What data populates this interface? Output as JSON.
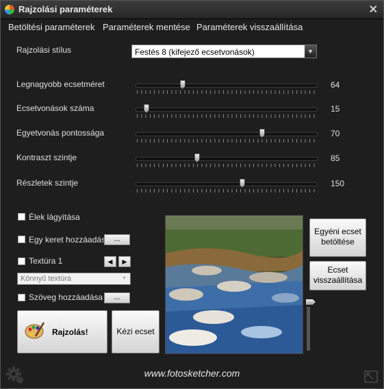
{
  "window": {
    "title": "Rajzolási paraméterek",
    "close_glyph": "✕"
  },
  "menu": [
    {
      "label": "Betöltési paraméterek"
    },
    {
      "label": "Paraméterek mentése"
    },
    {
      "label": "Paraméterek visszaállítása"
    }
  ],
  "style": {
    "label": "Rajzolási stílus",
    "selected": "Festés 8 (kifejező ecsetvonások)",
    "arrow_glyph": "▼"
  },
  "sliders": [
    {
      "label": "Legnagyobb ecsetméret",
      "value": "64",
      "fraction": 0.26
    },
    {
      "label": "Ecsetvonások száma",
      "value": "15",
      "fraction": 0.06
    },
    {
      "label": "Egyetvonás pontossága",
      "value": "70",
      "fraction": 0.7
    },
    {
      "label": "Kontraszt szintje",
      "value": "85",
      "fraction": 0.34
    },
    {
      "label": "Részletek szintje",
      "value": "150",
      "fraction": 0.59
    }
  ],
  "options": {
    "soften_edges": {
      "label": "Élek lágyítása",
      "checked": false
    },
    "add_frame": {
      "label": "Egy keret hozzáadása",
      "checked": false,
      "button": "..."
    },
    "texture": {
      "label": "Textúra 1",
      "checked": false,
      "prev_glyph": "◀",
      "next_glyph": "▶",
      "selected": "Könnyű textúra",
      "arrow_glyph": "▼"
    },
    "add_text": {
      "label": "Szöveg hozzáadása",
      "checked": false,
      "button": "..."
    }
  },
  "buttons": {
    "draw": "Rajzolás!",
    "manual_brush": "Kézi ecset",
    "load_custom_brush": "Egyéni ecset betöltése",
    "reset_brush": "Ecset visszaállítása"
  },
  "footer": {
    "link": "www.fotosketcher.com"
  },
  "icons": [
    "app-icon",
    "close-icon",
    "palette-icon",
    "gear-icon",
    "resize-icon"
  ]
}
